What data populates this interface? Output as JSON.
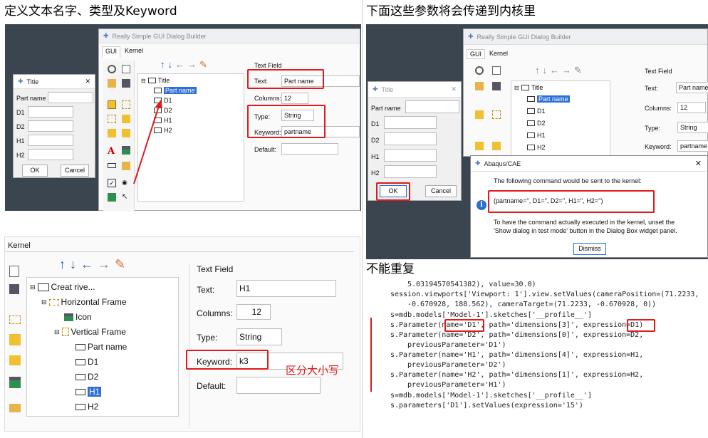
{
  "captions": {
    "q1": "定义文本名字、类型及Keyword",
    "q2": "下面这些参数将会传递到内核里",
    "q4": "不能重复",
    "case_note": "区分大小写"
  },
  "builder": {
    "title": "Really Simple GUI Dialog Builder",
    "tabs": [
      "GUI",
      "Kernel"
    ],
    "tree": [
      "Title",
      "Part name",
      "D1",
      "D2",
      "H1",
      "H2"
    ],
    "textfield_group": "Text Field",
    "fields": {
      "text_label": "Text:",
      "text_value": "Part name",
      "columns_label": "Columns:",
      "columns_value": "12",
      "type_label": "Type:",
      "type_value": "String",
      "keyword_label": "Keyword:",
      "keyword_value": "partname",
      "default_label": "Default:"
    }
  },
  "preview_dialog": {
    "title": "Title",
    "rows": [
      "Part name",
      "D1",
      "D2",
      "H1",
      "H2"
    ],
    "ok": "OK",
    "cancel": "Cancel"
  },
  "abaqus_msg": {
    "title": "Abaqus/CAE",
    "line1": "The following command would be sent to the kernel:",
    "command": "(partname='', D1='', D2='', H1='', H2='')",
    "line2": "To have the command actually executed in the kernel, unset the",
    "line3": "'Show dialog in test mode' button in the Dialog Box widget panel.",
    "dismiss": "Dismiss"
  },
  "kernel_panel": {
    "tab": "Kernel",
    "tree": [
      "Creat rive...",
      "Horizontal Frame",
      "Icon",
      "Vertical Frame",
      "Part name",
      "D1",
      "D2",
      "H1",
      "H2"
    ],
    "group": "Text Field",
    "text_label": "Text:",
    "text_value": "H1",
    "columns_label": "Columns:",
    "columns_value": "12",
    "type_label": "Type:",
    "type_value": "String",
    "keyword_label": "Keyword:",
    "keyword_value": "k3",
    "default_label": "Default:"
  },
  "code_lines": [
    "5.03194570541382), value=30.0)",
    "session.viewports['Viewport: 1'].view.setValues(cameraPosition=(71.2233,",
    "-0.670928, 188.562), cameraTarget=(71.2233, -0.670928, 0))",
    "s=mdb.models['Model-1'].sketches['__profile__']",
    "s.Parameter(name='D1', path='dimensions[3]', expression=D1)",
    "s.Parameter(name='D2', path='dimensions[0]', expression=D2,",
    "previousParameter='D1')",
    "s.Parameter(name='H1', path='dimensions[4]', expression=H1,",
    "previousParameter='D2')",
    "s.Parameter(name='H2', path='dimensions[1]', expression=H2,",
    "previousParameter='H1')",
    "s=mdb.models['Model-1'].sketches['__profile__']",
    "s.parameters['D1'].setValues(expression='15')"
  ],
  "colors": {
    "accent_red": "#e0191b",
    "selection_blue": "#2f6fd6",
    "dark_bg": "#3a4149"
  }
}
